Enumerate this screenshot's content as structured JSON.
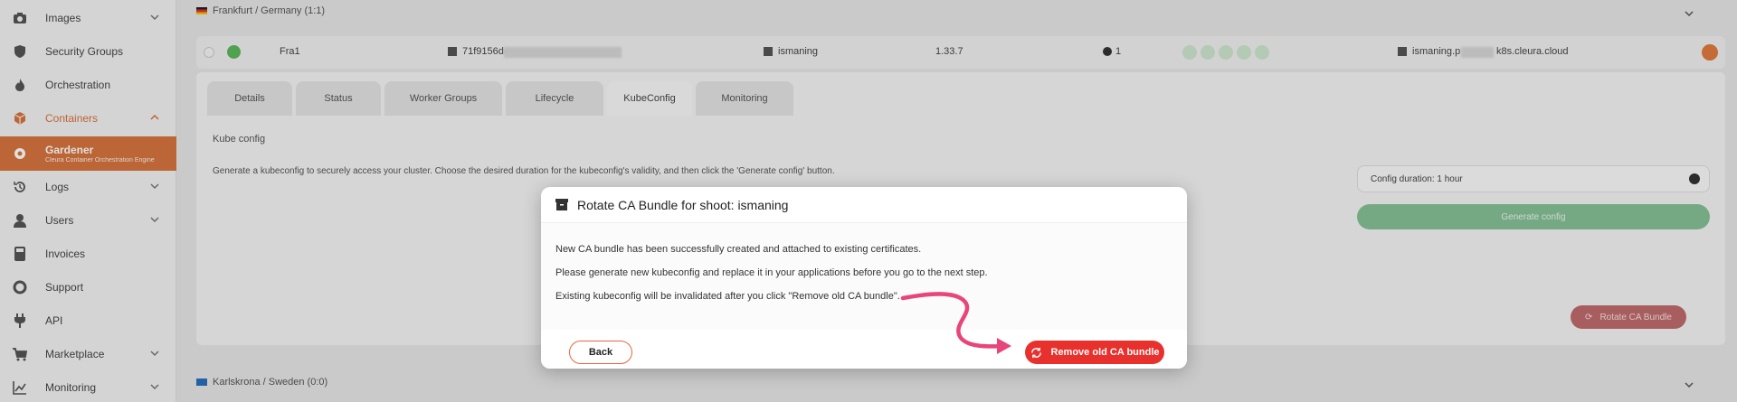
{
  "sidebar": {
    "items": [
      {
        "label": "Images",
        "icon": "camera-icon",
        "chevron": true
      },
      {
        "label": "Security Groups",
        "icon": "shield-icon",
        "chevron": false
      },
      {
        "label": "Orchestration",
        "icon": "flame-icon",
        "chevron": false
      },
      {
        "label": "Containers",
        "icon": "cubes-icon",
        "chevron": true
      },
      {
        "label": "Logs",
        "icon": "history-icon",
        "chevron": true
      },
      {
        "label": "Users",
        "icon": "user-icon",
        "chevron": true
      },
      {
        "label": "Invoices",
        "icon": "calculator-icon",
        "chevron": false
      },
      {
        "label": "Support",
        "icon": "lifebuoy-icon",
        "chevron": false
      },
      {
        "label": "API",
        "icon": "plug-icon",
        "chevron": false
      },
      {
        "label": "Marketplace",
        "icon": "cart-icon",
        "chevron": true
      },
      {
        "label": "Monitoring",
        "icon": "chart-icon",
        "chevron": true
      }
    ],
    "active": {
      "label": "Gardener",
      "sublabel": "Cleura Container Orchestration Engine"
    }
  },
  "regions": {
    "frankfurt": "Frankfurt / Germany (1:1)",
    "karlskrona": "Karlskrona / Sweden (0:0)"
  },
  "cluster": {
    "name": "Fra1",
    "id": "71f9156d-",
    "shoot": "ismaning",
    "version": "1.33.7",
    "count": "1",
    "domain_prefix": "ismaning.p",
    "domain_suffix": "k8s.cleura.cloud"
  },
  "tabs": [
    "Details",
    "Status",
    "Worker Groups",
    "Lifecycle",
    "KubeConfig",
    "Monitoring"
  ],
  "active_tab": "KubeConfig",
  "kubeconfig": {
    "heading": "Kube config",
    "description": "Generate a kubeconfig to securely access your cluster. Choose the desired duration for the kubeconfig's validity, and then click the 'Generate config' button.",
    "duration": "Config duration: 1 hour",
    "generate_label": "Generate config",
    "rotate_label": "Rotate CA Bundle"
  },
  "modal": {
    "title": "Rotate CA Bundle for shoot: ismaning",
    "line1": "New CA bundle has been successfully created and attached to existing certificates.",
    "line2": "Please generate new kubeconfig and replace it in your applications before you go to the next step.",
    "line3": "Existing kubeconfig will be invalidated after you click \"Remove old CA bundle\".",
    "back_label": "Back",
    "remove_label": "Remove old CA bundle"
  },
  "colors": {
    "brand": "#d7733e",
    "danger": "#e8302d",
    "success": "#86c196",
    "annotation": "#e8457a"
  }
}
